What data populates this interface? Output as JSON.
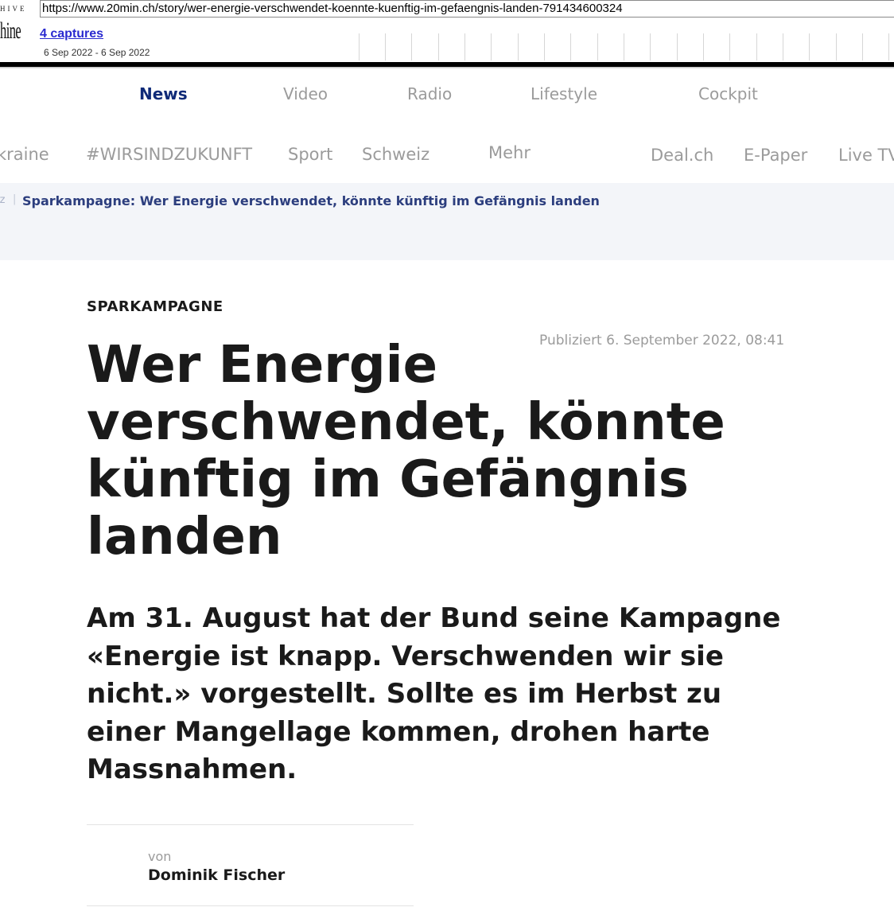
{
  "wayback": {
    "logo_top": "HIVE",
    "logo_main": "hine",
    "url": "https://www.20min.ch/story/wer-energie-verschwendet-koennte-kuenftig-im-gefaengnis-landen-791434600324",
    "captures_label": "4 captures",
    "date_range": "6 Sep 2022 - 6 Sep 2022"
  },
  "main_nav": {
    "items": [
      {
        "label": "News",
        "active": true
      },
      {
        "label": "Video",
        "active": false
      },
      {
        "label": "Radio",
        "active": false
      },
      {
        "label": "Lifestyle",
        "active": false
      },
      {
        "label": "Cockpit",
        "active": false
      }
    ]
  },
  "section_nav": {
    "items": [
      "kraine",
      "#WIRSINDZUKUNFT",
      "Sport",
      "Schweiz",
      "Mehr",
      "Deal.ch",
      "E-Paper",
      "Live TV"
    ]
  },
  "breadcrumb": {
    "previous": "iz",
    "separator": "|",
    "current": "Sparkampagne: Wer Energie verschwendet, könnte künftig im Gefängnis landen"
  },
  "article": {
    "kicker": "SPARKAMPAGNE",
    "published": "Publiziert 6. September 2022, 08:41",
    "headline": "Wer Energie verschwendet, könnte künftig im Gefängnis landen",
    "lead": "Am 31. August hat der Bund seine Kampagne «Energie ist knapp. Verschwenden wir sie nicht.» vorgestellt. Sollte es im Herbst zu einer Mangellage kommen, drohen harte Massnahmen.",
    "author": {
      "prefix": "von",
      "name": "Dominik Fischer"
    }
  },
  "colors": {
    "nav_active": "#0f2a78",
    "nav_inactive": "#9b9b9b",
    "breadcrumb_text": "#2c3e7e",
    "breadcrumb_bg": "#f3f5f9",
    "text": "#1a1a1a"
  }
}
